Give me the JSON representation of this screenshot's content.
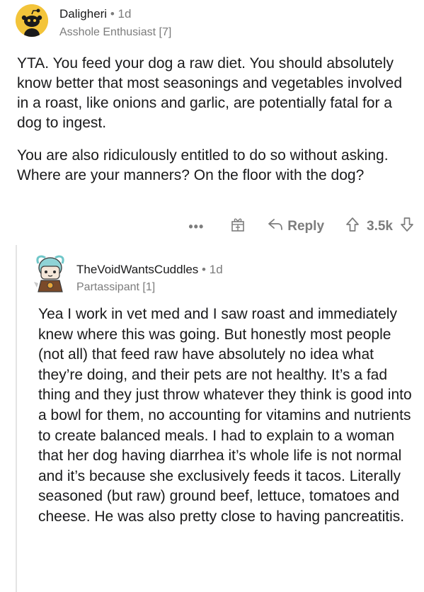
{
  "comment1": {
    "username": "Daligheri",
    "separator": "•",
    "age": "1d",
    "flair": "Asshole Enthusiast [7]",
    "paragraphs": [
      "YTA. You feed your dog a raw diet. You should absolutely know better that most seasonings and vegetables involved in a roast, like onions and garlic, are potentially fatal for a dog to ingest.",
      "You are also ridiculously entitled to do so without asking. Where are your manners? On the floor with the dog?"
    ],
    "actions": {
      "more": "•••",
      "reply_label": "Reply",
      "score": "3.5k"
    }
  },
  "comment2": {
    "username": "TheVoidWantsCuddles",
    "separator": "•",
    "age": "1d",
    "flair": "Partassipant [1]",
    "body": "Yea I work in vet med and I saw roast and immediately knew where this was going. But honestly most people (not all) that feed raw have absolutely no idea what they’re doing, and their pets are not healthy. It’s a fad thing and they just throw whatever they think is good into a bowl for them, no accounting for vitamins and nutrients to create balanced meals. I had to explain to a woman that her dog having diarrhea it’s whole life is not normal and it’s because she exclusively feeds it tacos. Literally seasoned (but raw) ground beef, lettuce, tomatoes and cheese. He was also pretty close to having pancreatitis."
  },
  "colors": {
    "text": "#1a1a1b",
    "meta": "#7c7c7c",
    "avatar_bg": "#f3c43a",
    "thread_line": "#e4e4e4"
  },
  "icons": [
    "snoo-avatar-icon",
    "award-gift-icon",
    "reply-arrow-icon",
    "upvote-arrow-icon",
    "downvote-arrow-icon",
    "user-avatar-icon"
  ]
}
